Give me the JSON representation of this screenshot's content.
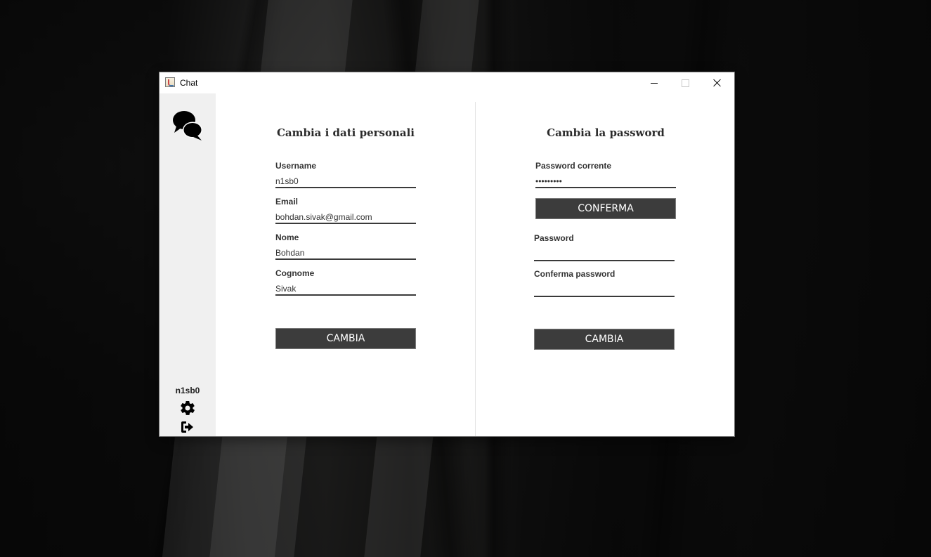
{
  "window": {
    "title": "Chat"
  },
  "sidebar": {
    "username": "n1sb0"
  },
  "personal": {
    "title": "Cambia i dati personali",
    "username_label": "Username",
    "username_value": "n1sb0",
    "email_label": "Email",
    "email_value": "bohdan.sivak@gmail.com",
    "nome_label": "Nome",
    "nome_value": "Bohdan",
    "cognome_label": "Cognome",
    "cognome_value": "Sivak",
    "submit_label": "CAMBIA"
  },
  "password": {
    "title": "Cambia la password",
    "current_label": "Password corrente",
    "current_value": "•••••••••",
    "confirm_current_label": "CONFERMA",
    "new_label": "Password",
    "new_value": "",
    "confirm_new_label": "Conferma password",
    "confirm_new_value": "",
    "submit_label": "CAMBIA"
  },
  "icons": {
    "app": "java-icon",
    "logo": "chat-bubbles-icon",
    "settings": "gear-icon",
    "logout": "logout-icon"
  },
  "colors": {
    "button_bg": "#3c3c3c",
    "sidebar_bg": "#f0f0f0",
    "underline": "#3a3a3a"
  }
}
